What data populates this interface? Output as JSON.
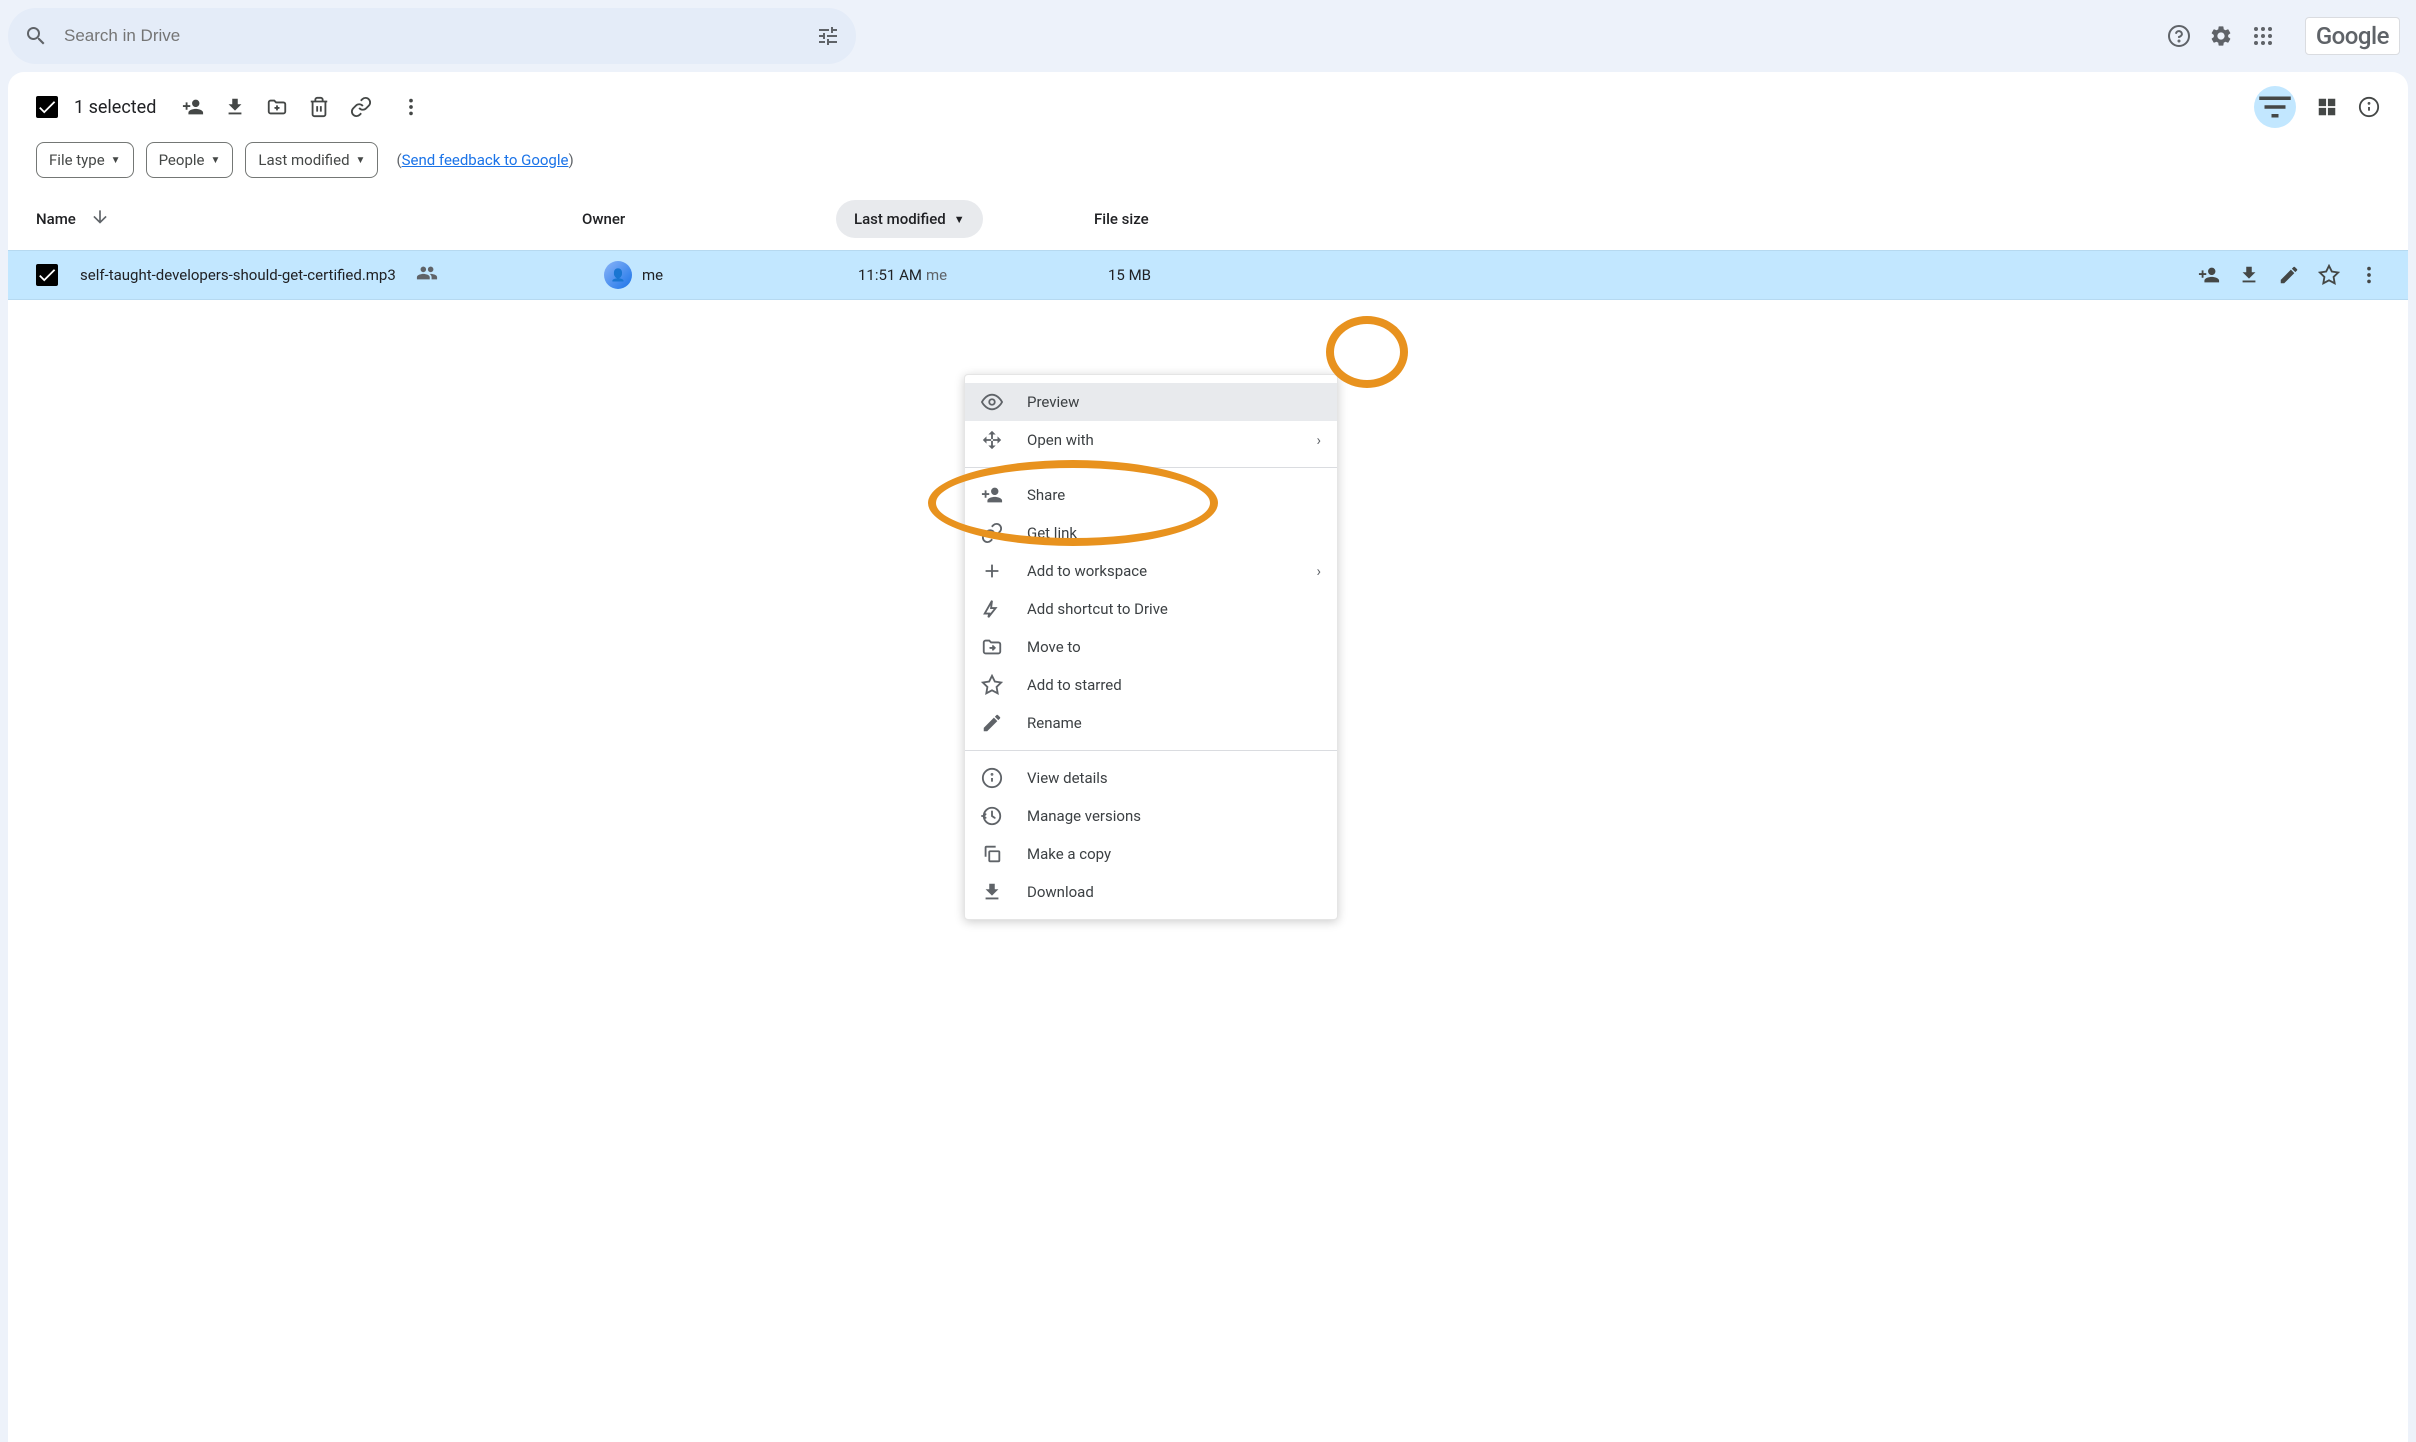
{
  "search": {
    "placeholder": "Search in Drive"
  },
  "google_logo": "Google",
  "selection": {
    "count_label": "1 selected"
  },
  "filters": {
    "file_type": "File type",
    "people": "People",
    "last_modified": "Last modified",
    "feedback_prefix": "(",
    "feedback_link": "Send feedback to Google",
    "feedback_suffix": ")"
  },
  "columns": {
    "name": "Name",
    "owner": "Owner",
    "modified": "Last modified",
    "size": "File size"
  },
  "row": {
    "name": "self-taught-developers-should-get-certified.mp3",
    "owner": "me",
    "modified_time": "11:51 AM",
    "modified_by": "me",
    "size": "15 MB"
  },
  "menu": {
    "preview": "Preview",
    "open_with": "Open with",
    "share": "Share",
    "get_link": "Get link",
    "add_workspace": "Add to workspace",
    "add_shortcut": "Add shortcut to Drive",
    "move_to": "Move to",
    "add_starred": "Add to starred",
    "rename": "Rename",
    "view_details": "View details",
    "manage_versions": "Manage versions",
    "make_copy": "Make a copy",
    "download": "Download"
  }
}
